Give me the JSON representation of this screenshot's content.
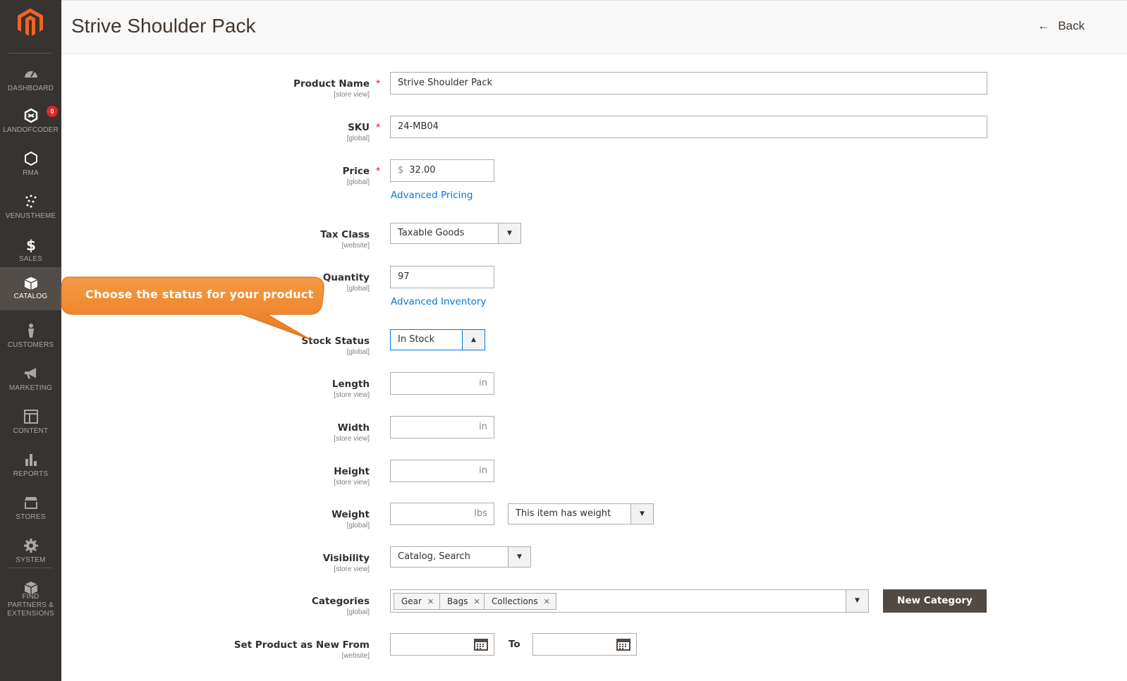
{
  "sidebar": {
    "badge": "0",
    "items": [
      {
        "label": "DASHBOARD",
        "icon": "dashboard-icon"
      },
      {
        "label": "LANDOFCODER",
        "icon": "landofcoder-icon"
      },
      {
        "label": "RMA",
        "icon": "hexagon-icon"
      },
      {
        "label": "VENUSTHEME",
        "icon": "venustheme-icon"
      },
      {
        "label": "SALES",
        "icon": "dollar-icon"
      },
      {
        "label": "CATALOG",
        "icon": "box-icon"
      },
      {
        "label": "CUSTOMERS",
        "icon": "person-icon"
      },
      {
        "label": "MARKETING",
        "icon": "megaphone-icon"
      },
      {
        "label": "CONTENT",
        "icon": "layout-icon"
      },
      {
        "label": "REPORTS",
        "icon": "bar-chart-icon"
      },
      {
        "label": "STORES",
        "icon": "store-icon"
      },
      {
        "label": "SYSTEM",
        "icon": "gear-icon"
      },
      {
        "label": "FIND PARTNERS & EXTENSIONS",
        "icon": "partners-icon"
      }
    ],
    "active": "CATALOG"
  },
  "header": {
    "title": "Strive Shoulder Pack",
    "back_label": "Back"
  },
  "callout": {
    "text": "Choose the status for your product",
    "color": "#f08123"
  },
  "form": {
    "product_name": {
      "label": "Product Name",
      "scope": "[store view]",
      "value": "Strive Shoulder Pack",
      "required": true
    },
    "sku": {
      "label": "SKU",
      "scope": "[global]",
      "value": "24-MB04",
      "required": true
    },
    "price": {
      "label": "Price",
      "scope": "[global]",
      "currency": "$",
      "value": "32.00",
      "required": true,
      "link": "Advanced Pricing"
    },
    "tax_class": {
      "label": "Tax Class",
      "scope": "[website]",
      "value": "Taxable Goods"
    },
    "quantity": {
      "label": "Quantity",
      "scope": "[global]",
      "value": "97",
      "link": "Advanced Inventory"
    },
    "stock_status": {
      "label": "Stock Status",
      "scope": "[global]",
      "value": "In Stock"
    },
    "length": {
      "label": "Length",
      "scope": "[store view]",
      "unit": "in"
    },
    "width": {
      "label": "Width",
      "scope": "[store view]",
      "unit": "in"
    },
    "height": {
      "label": "Height",
      "scope": "[store view]",
      "unit": "in"
    },
    "weight": {
      "label": "Weight",
      "scope": "[global]",
      "unit": "lbs",
      "has_weight": "This item has weight"
    },
    "visibility": {
      "label": "Visibility",
      "scope": "[store view]",
      "value": "Catalog, Search"
    },
    "categories": {
      "label": "Categories",
      "scope": "[global]",
      "tags": [
        "Gear",
        "Bags",
        "Collections"
      ],
      "new_button": "New Category"
    },
    "new_from": {
      "label": "Set Product as New From",
      "scope": "[website]",
      "to_label": "To"
    }
  },
  "colors": {
    "sidebar": "#373330",
    "accent": "#007bdb",
    "required": "#e22626",
    "button_dark": "#514943"
  }
}
